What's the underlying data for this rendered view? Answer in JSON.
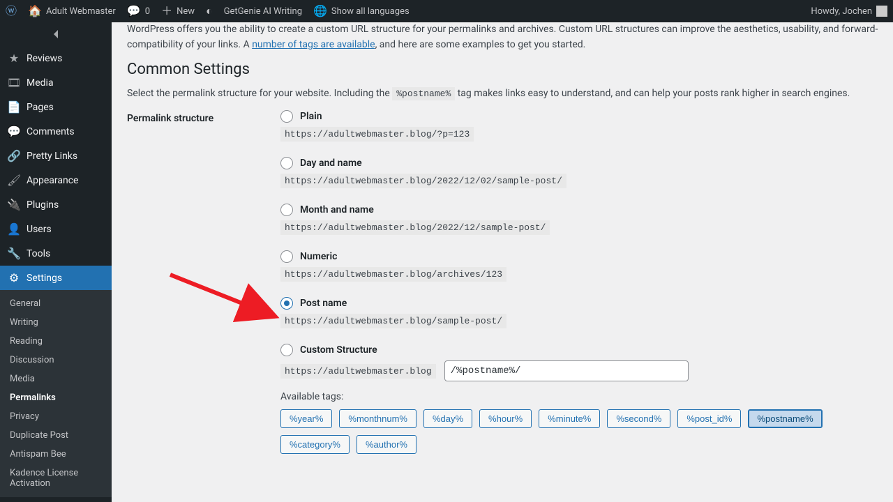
{
  "adminbar": {
    "site": "Adult Webmaster",
    "comments": "0",
    "new": "New",
    "genie": "GetGenie AI Writing",
    "langs": "Show all languages",
    "howdy": "Howdy, Jochen"
  },
  "sidebar": {
    "items": [
      {
        "label": "Reviews"
      },
      {
        "label": "Media"
      },
      {
        "label": "Pages"
      },
      {
        "label": "Comments"
      },
      {
        "label": "Pretty Links"
      },
      {
        "label": "Appearance"
      },
      {
        "label": "Plugins"
      },
      {
        "label": "Users"
      },
      {
        "label": "Tools"
      },
      {
        "label": "Settings"
      }
    ],
    "submenu": [
      {
        "label": "General"
      },
      {
        "label": "Writing"
      },
      {
        "label": "Reading"
      },
      {
        "label": "Discussion"
      },
      {
        "label": "Media"
      },
      {
        "label": "Permalinks"
      },
      {
        "label": "Privacy"
      },
      {
        "label": "Duplicate Post"
      },
      {
        "label": "Antispam Bee"
      },
      {
        "label": "Kadence License Activation"
      }
    ]
  },
  "page": {
    "intro1": "WordPress offers you the ability to create a custom URL structure for your permalinks and archives. Custom URL structures can improve the aesthetics, usability, and forward-compatibility of your links. A ",
    "intro_link": "number of tags are available",
    "intro2": ", and here are some examples to get you started.",
    "heading": "Common Settings",
    "sub1": "Select the permalink structure for your website. Including the ",
    "sub_tag": "%postname%",
    "sub2": " tag makes links easy to understand, and can help your posts rank higher in search engines.",
    "rowlabel": "Permalink structure",
    "options": [
      {
        "label": "Plain",
        "example": "https://adultwebmaster.blog/?p=123"
      },
      {
        "label": "Day and name",
        "example": "https://adultwebmaster.blog/2022/12/02/sample-post/"
      },
      {
        "label": "Month and name",
        "example": "https://adultwebmaster.blog/2022/12/sample-post/"
      },
      {
        "label": "Numeric",
        "example": "https://adultwebmaster.blog/archives/123"
      },
      {
        "label": "Post name",
        "example": "https://adultwebmaster.blog/sample-post/"
      },
      {
        "label": "Custom Structure"
      }
    ],
    "selected": 4,
    "custom_prefix": "https://adultwebmaster.blog",
    "custom_value": "/%postname%/",
    "available": "Available tags:",
    "tags": [
      "%year%",
      "%monthnum%",
      "%day%",
      "%hour%",
      "%minute%",
      "%second%",
      "%post_id%",
      "%postname%",
      "%category%",
      "%author%"
    ],
    "tag_selected": 7
  }
}
